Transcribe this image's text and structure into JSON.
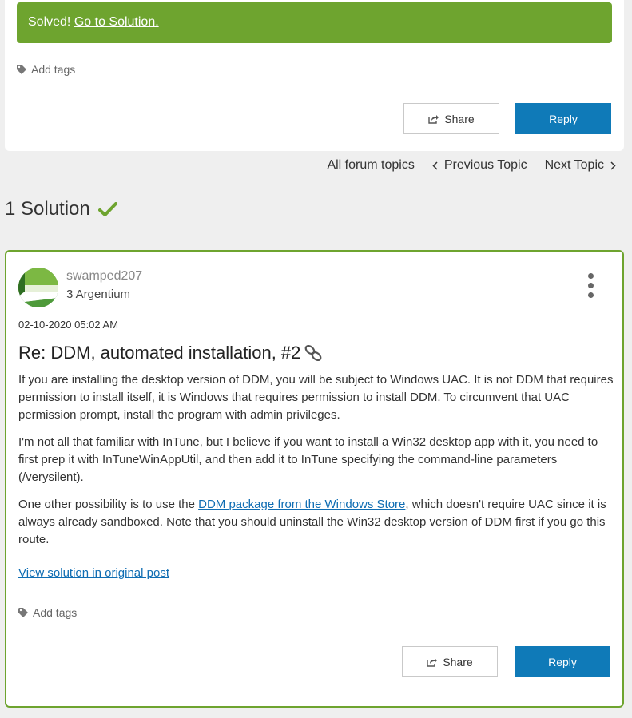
{
  "banner": {
    "solved_label": "Solved!",
    "solution_link": "Go to Solution."
  },
  "top_card": {
    "add_tags": "Add tags",
    "share_label": "Share",
    "reply_label": "Reply"
  },
  "topic_nav": {
    "all_topics": "All forum topics",
    "previous": "Previous Topic",
    "next": "Next Topic"
  },
  "solutions": {
    "heading": "1 Solution"
  },
  "post": {
    "author": "swamped207",
    "rank": "3 Argentium",
    "date": "02-10-2020 05:02 AM",
    "title": "Re: DDM, automated installation, #2",
    "para1": "If you are installing the desktop version of DDM, you will be subject to Windows UAC. It is not DDM that requires permission to install itself, it is Windows that requires permission to install DDM. To circumvent that UAC permission prompt, install the program with admin privileges.",
    "para2": "I'm not all that familiar with InTune, but I believe if you want to install a Win32 desktop app with it, you need to first prep it with InTuneWinAppUtil, and then add it to InTune specifying the command-line parameters (/verysilent).",
    "para3_before": "One other possibility is to use the ",
    "para3_link": "DDM package from the Windows Store",
    "para3_after": ", which doesn't require UAC since it is always already sandboxed.  Note that you should uninstall the Win32 desktop version of DDM first if you go this route.",
    "view_solution": "View solution in original post",
    "add_tags": "Add tags",
    "share_label": "Share",
    "reply_label": "Reply"
  },
  "colors": {
    "accent_green": "#6ea42f",
    "reply_blue": "#0f7ab8",
    "link_blue": "#0f6db3"
  },
  "icons": [
    "tag-icon",
    "share-icon",
    "chevron-left-icon",
    "chevron-right-icon",
    "checkmark-icon",
    "kebab-menu-icon",
    "permalink-icon"
  ]
}
